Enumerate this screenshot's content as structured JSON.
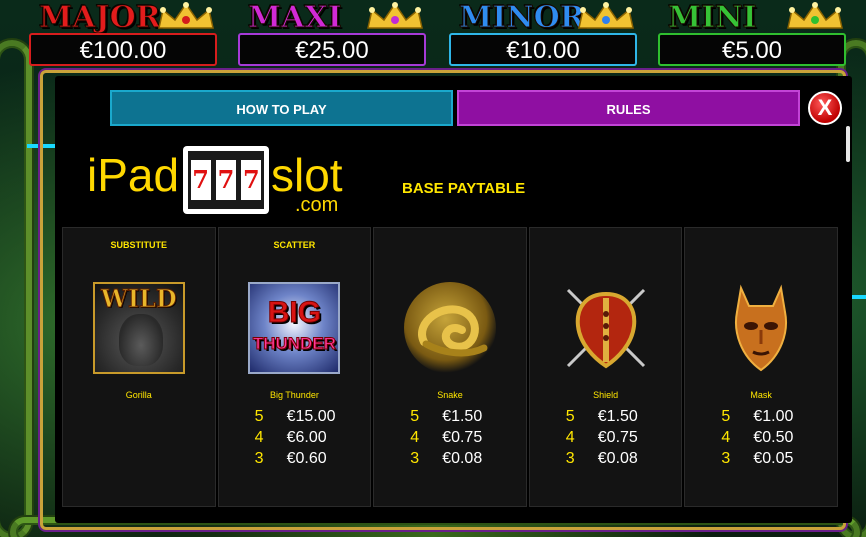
{
  "jackpots": [
    {
      "title": "MAJOR",
      "amount": "€100.00"
    },
    {
      "title": "MAXI",
      "amount": "€25.00"
    },
    {
      "title": "MINOR",
      "amount": "€10.00"
    },
    {
      "title": "MINI",
      "amount": "€5.00"
    }
  ],
  "tabs": {
    "how_to_play": "HOW TO PLAY",
    "rules": "RULES"
  },
  "close_label": "X",
  "logo": {
    "left": "iPad",
    "reel": [
      "7",
      "7",
      "7"
    ],
    "right": "slot",
    "domain": ".com"
  },
  "paytable_title": "BASE PAYTABLE",
  "symbols": [
    {
      "category": "SUBSTITUTE",
      "name": "Gorilla",
      "icon": "gorilla-wild-icon",
      "label": "WILD",
      "pays": []
    },
    {
      "category": "SCATTER",
      "name": "Big Thunder",
      "icon": "big-thunder-icon",
      "label1": "BIG",
      "label2": "THUNDER",
      "pays": [
        {
          "count": "5",
          "value": "€15.00"
        },
        {
          "count": "4",
          "value": "€6.00"
        },
        {
          "count": "3",
          "value": "€0.60"
        }
      ]
    },
    {
      "category": "",
      "name": "Snake",
      "icon": "snake-icon",
      "pays": [
        {
          "count": "5",
          "value": "€1.50"
        },
        {
          "count": "4",
          "value": "€0.75"
        },
        {
          "count": "3",
          "value": "€0.08"
        }
      ]
    },
    {
      "category": "",
      "name": "Shield",
      "icon": "shield-icon",
      "pays": [
        {
          "count": "5",
          "value": "€1.50"
        },
        {
          "count": "4",
          "value": "€0.75"
        },
        {
          "count": "3",
          "value": "€0.08"
        }
      ]
    },
    {
      "category": "",
      "name": "Mask",
      "icon": "mask-icon",
      "pays": [
        {
          "count": "5",
          "value": "€1.00"
        },
        {
          "count": "4",
          "value": "€0.50"
        },
        {
          "count": "3",
          "value": "€0.05"
        }
      ]
    }
  ]
}
